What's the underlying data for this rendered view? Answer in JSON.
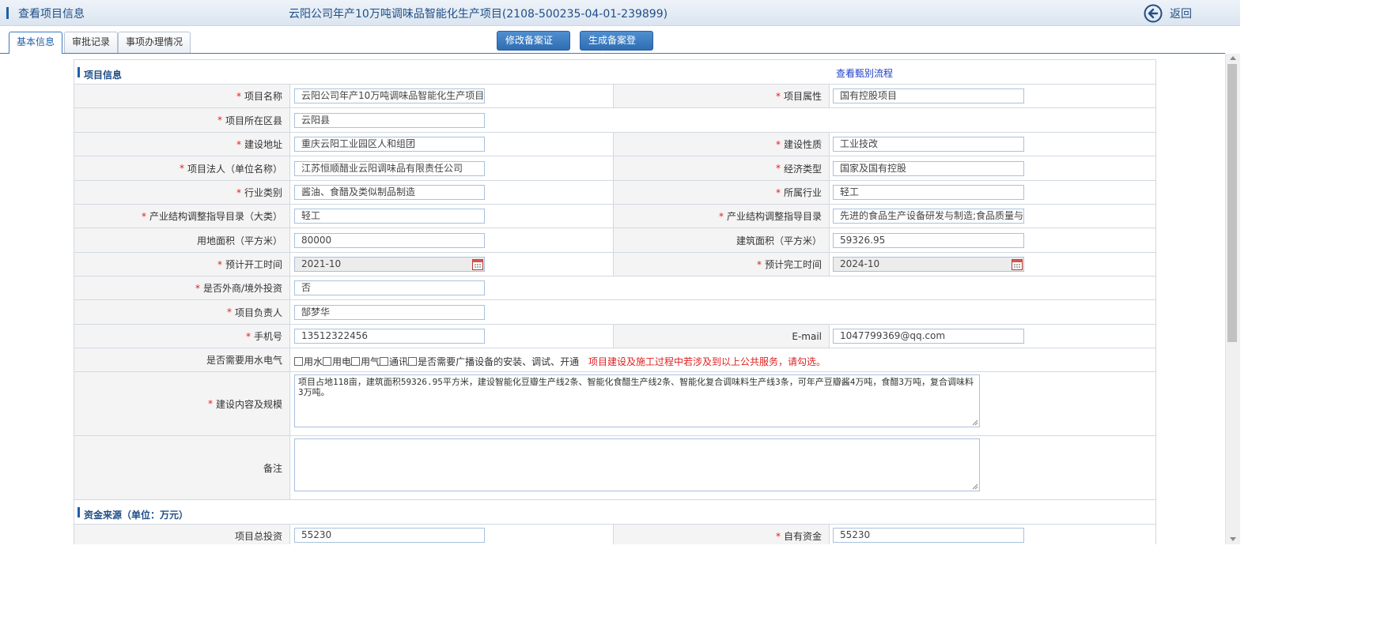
{
  "header": {
    "title": "查看项目信息",
    "project_heading": "云阳公司年产10万吨调味品智能化生产项目(2108-500235-04-01-239899)",
    "back_label": "返回"
  },
  "tabs": [
    "基本信息",
    "审批记录",
    "事项办理情况"
  ],
  "actions": {
    "modify_filing": "修改备案证号",
    "generate_filing": "生成备案登记表"
  },
  "section_project": {
    "title": "项目信息",
    "flow_link": "查看甄别流程"
  },
  "fields": {
    "project_name": {
      "label": "项目名称",
      "value": "云阳公司年产10万吨调味品智能化生产项目"
    },
    "project_attr": {
      "label": "项目属性",
      "value": "国有控股项目"
    },
    "region": {
      "label": "项目所在区县",
      "value": "云阳县"
    },
    "address": {
      "label": "建设地址",
      "value": "重庆云阳工业园区人和组团"
    },
    "nature": {
      "label": "建设性质",
      "value": "工业技改"
    },
    "legal_person": {
      "label": "项目法人（单位名称）",
      "value": "江苏恒顺醋业云阳调味品有限责任公司"
    },
    "econ_type": {
      "label": "经济类型",
      "value": "国家及国有控股"
    },
    "industry_cat": {
      "label": "行业类别",
      "value": "酱油、食醋及类似制品制造"
    },
    "industry": {
      "label": "所属行业",
      "value": "轻工"
    },
    "catalog_major": {
      "label": "产业结构调整指导目录（大类）",
      "value": "轻工"
    },
    "catalog": {
      "label": "产业结构调整指导目录",
      "value": "先进的食品生产设备研发与制造;食品质量与"
    },
    "land_area": {
      "label": "用地面积（平方米）",
      "value": "80000"
    },
    "build_area": {
      "label": "建筑面积（平方米）",
      "value": "59326.95"
    },
    "start_time": {
      "label": "预计开工时间",
      "value": "2021-10"
    },
    "end_time": {
      "label": "预计完工时间",
      "value": "2024-10"
    },
    "foreign": {
      "label": "是否外商/境外投资",
      "value": "否"
    },
    "manager": {
      "label": "项目负责人",
      "value": "郜梦华"
    },
    "phone": {
      "label": "手机号",
      "value": "13512322456"
    },
    "email": {
      "label": "E-mail",
      "value": "1047799369@qq.com"
    },
    "utilities": {
      "label": "是否需要用水电气",
      "options": [
        "用水",
        "用电",
        "用气",
        "通讯",
        "是否需要广播设备的安装、调试、开通"
      ],
      "notice": "项目建设及施工过程中若涉及到以上公共服务，请勾选。"
    },
    "scope": {
      "label": "建设内容及规模",
      "value": "项目占地118亩，建筑面积59326.95平方米，建设智能化豆瓣生产线2条、智能化食醋生产线2条、智能化复合调味料生产线3条，可年产豆瓣酱4万吨，食醋3万吨，复合调味料3万吨。"
    },
    "remark": {
      "label": "备注",
      "value": ""
    }
  },
  "section_funds": {
    "title": "资金来源（单位：万元）"
  },
  "funds": {
    "total": {
      "label": "项目总投资",
      "value": "55230"
    },
    "own": {
      "label": "自有资金",
      "value": "55230"
    }
  },
  "required_mark": "*",
  "colors": {
    "accent": "#1f5fa8",
    "required": "#e02020",
    "button": "#2f6db3"
  }
}
